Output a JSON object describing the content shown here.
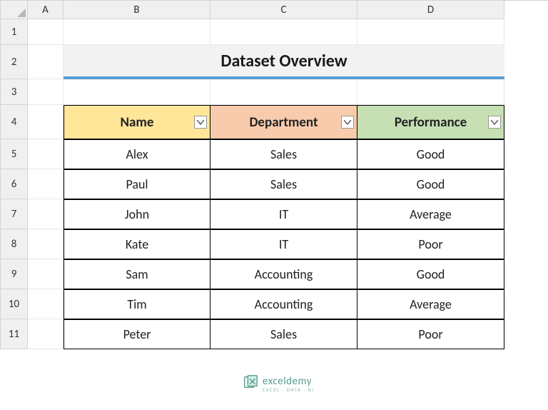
{
  "columns": [
    "A",
    "B",
    "C",
    "D"
  ],
  "rows": [
    "1",
    "2",
    "3",
    "4",
    "5",
    "6",
    "7",
    "8",
    "9",
    "10",
    "11"
  ],
  "title": "Dataset Overview",
  "headers": {
    "name": "Name",
    "department": "Department",
    "performance": "Performance"
  },
  "data": [
    {
      "name": "Alex",
      "department": "Sales",
      "performance": "Good"
    },
    {
      "name": "Paul",
      "department": "Sales",
      "performance": "Good"
    },
    {
      "name": "John",
      "department": "IT",
      "performance": "Average"
    },
    {
      "name": "Kate",
      "department": "IT",
      "performance": "Poor"
    },
    {
      "name": "Sam",
      "department": "Accounting",
      "performance": "Good"
    },
    {
      "name": "Tim",
      "department": "Accounting",
      "performance": "Average"
    },
    {
      "name": "Peter",
      "department": "Sales",
      "performance": "Poor"
    }
  ],
  "watermark": {
    "main": "exceldemy",
    "sub": "EXCEL · DATA · BI"
  },
  "chart_data": {
    "type": "table",
    "title": "Dataset Overview",
    "columns": [
      "Name",
      "Department",
      "Performance"
    ],
    "rows": [
      [
        "Alex",
        "Sales",
        "Good"
      ],
      [
        "Paul",
        "Sales",
        "Good"
      ],
      [
        "John",
        "IT",
        "Average"
      ],
      [
        "Kate",
        "IT",
        "Poor"
      ],
      [
        "Sam",
        "Accounting",
        "Good"
      ],
      [
        "Tim",
        "Accounting",
        "Average"
      ],
      [
        "Peter",
        "Sales",
        "Poor"
      ]
    ]
  }
}
